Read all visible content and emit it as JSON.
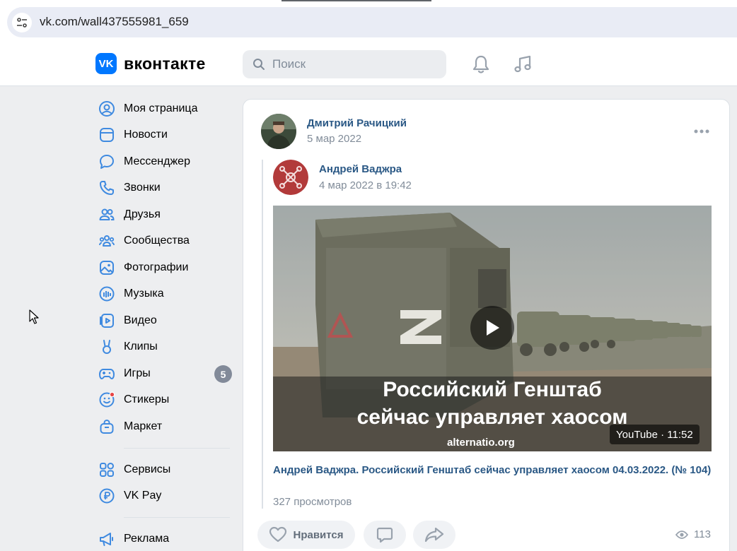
{
  "browser": {
    "url": "vk.com/wall437555981_659"
  },
  "header": {
    "logo_mark": "VK",
    "logo_text": "вконтакте",
    "search_placeholder": "Поиск",
    "icons": [
      "bell-icon",
      "music-icon"
    ]
  },
  "sidebar": {
    "items": [
      {
        "label": "Моя страница",
        "icon": "user-circle-icon"
      },
      {
        "label": "Новости",
        "icon": "news-icon"
      },
      {
        "label": "Мессенджер",
        "icon": "message-icon"
      },
      {
        "label": "Звонки",
        "icon": "phone-icon"
      },
      {
        "label": "Друзья",
        "icon": "friends-icon"
      },
      {
        "label": "Сообщества",
        "icon": "communities-icon"
      },
      {
        "label": "Фотографии",
        "icon": "photo-icon"
      },
      {
        "label": "Музыка",
        "icon": "music-icon"
      },
      {
        "label": "Видео",
        "icon": "video-icon"
      },
      {
        "label": "Клипы",
        "icon": "clips-icon"
      },
      {
        "label": "Игры",
        "icon": "games-icon",
        "badge": "5"
      },
      {
        "label": "Стикеры",
        "icon": "stickers-icon"
      },
      {
        "label": "Маркет",
        "icon": "market-icon"
      },
      {
        "label": "Сервисы",
        "icon": "services-icon"
      },
      {
        "label": "VK Pay",
        "icon": "vkpay-icon"
      },
      {
        "label": "Реклама",
        "icon": "megaphone-icon"
      }
    ]
  },
  "post": {
    "author": "Дмитрий Рачицкий",
    "date": "5 мар 2022",
    "repost": {
      "author": "Андрей Ваджра",
      "date": "4 мар 2022 в 19:42",
      "video": {
        "overlay_line1": "Российский Генштаб",
        "overlay_line2": "сейчас управляет хаосом",
        "overlay_site": "alternatio.org",
        "duration": "YouTube · 11:52",
        "title": "Андрей Ваджра. Российский Генштаб сейчас управляет хаосом 04.03.2022. (№ 104)",
        "views": "327 просмотров"
      }
    },
    "actions": {
      "like_label": "Нравится",
      "view_count": "113"
    }
  },
  "colors": {
    "accent": "#0077ff",
    "link": "#2a5885",
    "muted": "#818c99",
    "page_bg": "#edeef0",
    "sidebar_icon": "#3f8ae0"
  }
}
